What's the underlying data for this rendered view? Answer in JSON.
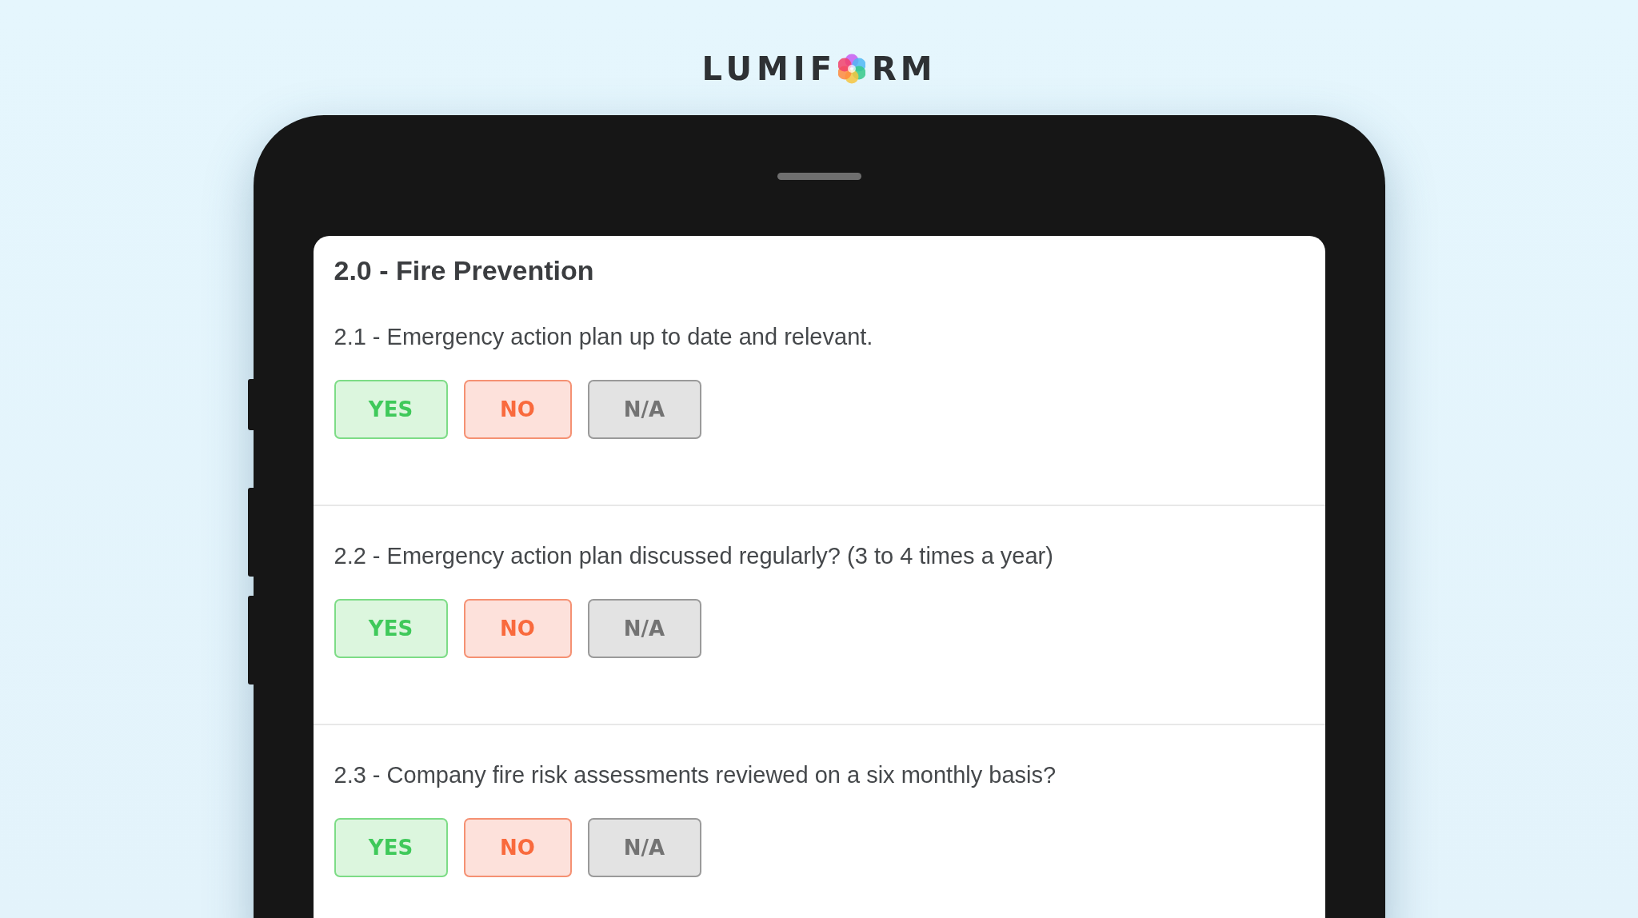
{
  "logo": {
    "before": "LUMIF",
    "after": "RM"
  },
  "section": {
    "title": "2.0 - Fire Prevention"
  },
  "questions": [
    {
      "text": "2.1 - Emergency action plan up to date and relevant.",
      "answers": [
        {
          "label": "YES",
          "kind": "yes",
          "selected": false
        },
        {
          "label": "NO",
          "kind": "no",
          "selected": false
        },
        {
          "label": "N/A",
          "kind": "na",
          "selected": false
        }
      ]
    },
    {
      "text": "2.2 - Emergency action plan discussed regularly? (3 to 4 times a year)",
      "answers": [
        {
          "label": "YES",
          "kind": "yes",
          "selected": false
        },
        {
          "label": "NO",
          "kind": "no",
          "selected": false
        },
        {
          "label": "N/A",
          "kind": "na",
          "selected": false
        }
      ]
    },
    {
      "text": "2.3 - Company fire risk assessments reviewed on a six monthly basis?",
      "answers": [
        {
          "label": "YES",
          "kind": "yes",
          "selected": false
        },
        {
          "label": "NO",
          "kind": "no",
          "selected": false
        },
        {
          "label": "N/A",
          "kind": "na",
          "selected": false
        }
      ]
    }
  ]
}
